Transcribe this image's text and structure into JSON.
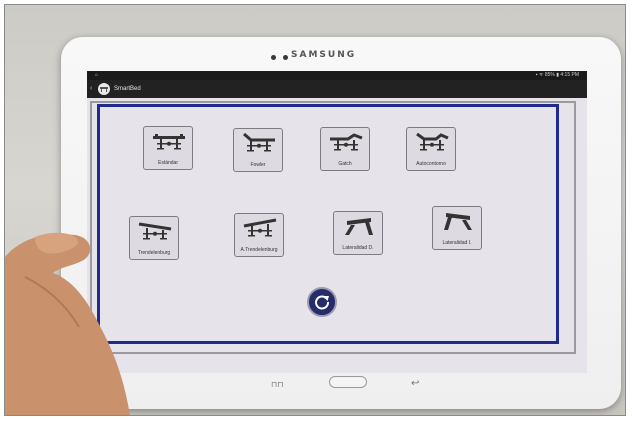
{
  "device": {
    "brand": "SAMSUNG"
  },
  "status_bar": {
    "left_text": "⌂",
    "right_text": "▪ ᯤ 85% ▮ 4:15 PM"
  },
  "action_bar": {
    "title": "SmartBed",
    "back_glyph": "‹"
  },
  "positions": [
    {
      "label": "Estándar"
    },
    {
      "label": "Fowler"
    },
    {
      "label": "Gatch"
    },
    {
      "label": "Autocontorno"
    },
    {
      "label": "Trendelenburg"
    },
    {
      "label": "A.Trendelenburg"
    },
    {
      "label": "Lateralidad D."
    },
    {
      "label": "Lateralidad I."
    }
  ],
  "nav": {
    "recent_glyph": "⊓⊓",
    "back_glyph": "↩"
  },
  "colors": {
    "frame_blue": "#1f2a8a",
    "content_bg": "#e6e3ea",
    "refresh_bg": "#262b6a"
  }
}
